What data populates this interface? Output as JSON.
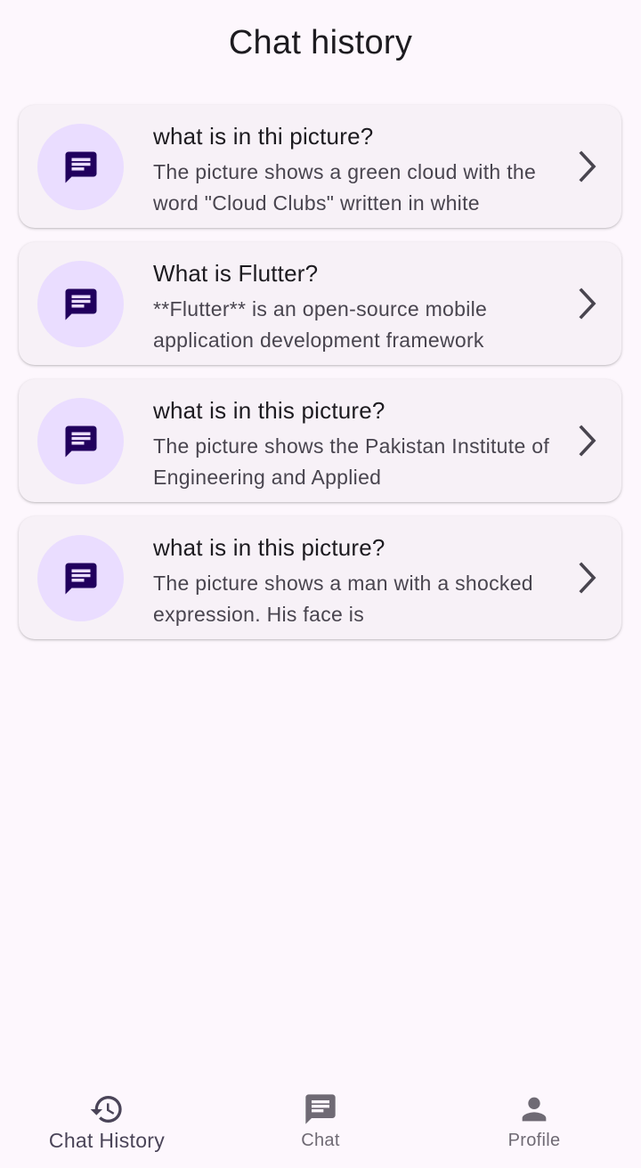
{
  "app_bar": {
    "title": "Chat history"
  },
  "history": [
    {
      "title": "what is in thi picture?",
      "subtitle": "The picture shows a green cloud with the word \"Cloud Clubs\" written in white",
      "icon": "chat-bubble-icon"
    },
    {
      "title": "What is Flutter?",
      "subtitle": "**Flutter** is an open-source mobile application development framework",
      "icon": "chat-bubble-icon"
    },
    {
      "title": "what is in this picture?",
      "subtitle": "The picture shows the Pakistan Institute of Engineering and Applied",
      "icon": "chat-bubble-icon"
    },
    {
      "title": "what is in this picture?",
      "subtitle": "The picture shows a man with a shocked expression. His face is",
      "icon": "chat-bubble-icon"
    }
  ],
  "bottom_nav": {
    "items": [
      {
        "label": "Chat History",
        "icon": "history-icon",
        "active": true
      },
      {
        "label": "Chat",
        "icon": "chat-icon",
        "active": false
      },
      {
        "label": "Profile",
        "icon": "person-icon",
        "active": false
      }
    ]
  },
  "colors": {
    "background": "#fdf7fd",
    "card": "#f7f1f7",
    "avatar": "#eaddff",
    "icon_dark": "#21005d",
    "nav_active": "#4a4458",
    "nav_inactive": "#6f6a74"
  }
}
